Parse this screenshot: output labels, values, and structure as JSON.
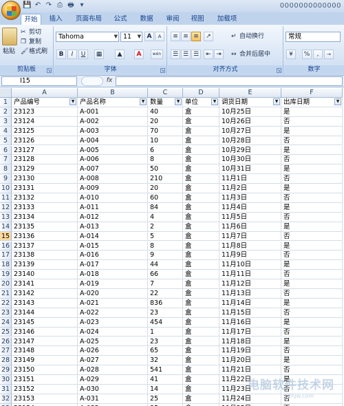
{
  "window": {
    "title": "0000000000000"
  },
  "quick_access": {
    "icons": [
      "save-icon",
      "undo-icon",
      "redo-icon",
      "print-preview-icon",
      "quick-print-icon",
      "customize-icon"
    ]
  },
  "tabs": [
    {
      "label": "开始",
      "active": true
    },
    {
      "label": "插入"
    },
    {
      "label": "页面布局"
    },
    {
      "label": "公式"
    },
    {
      "label": "数据"
    },
    {
      "label": "审阅"
    },
    {
      "label": "视图"
    },
    {
      "label": "加载项"
    }
  ],
  "ribbon": {
    "clipboard": {
      "label": "剪贴板",
      "paste": "粘贴",
      "cut": "剪切",
      "copy": "复制",
      "format_painter": "格式刷"
    },
    "font": {
      "label": "字体",
      "font_name": "Tahoma",
      "font_size": "11",
      "grow": "A",
      "shrink": "A",
      "bold": "B",
      "italic": "I",
      "underline": "U",
      "font_color_glyph": "A",
      "phonetic": "wén"
    },
    "alignment": {
      "label": "对齐方式",
      "wrap_text": "自动换行",
      "merge_center": "合并后居中"
    },
    "number": {
      "label": "数字",
      "format": "常规",
      "percent": "%",
      "comma": ","
    }
  },
  "formula_bar": {
    "name_box": "I15",
    "fx": "fx",
    "formula": ""
  },
  "columns": [
    "A",
    "B",
    "C",
    "D",
    "E",
    "F"
  ],
  "header_row": [
    "产品编号",
    "产品名称",
    "数量",
    "单位",
    "调货日期",
    "出库日期"
  ],
  "selected_row": 15,
  "rows": [
    [
      "23123",
      "A-001",
      "40",
      "盒",
      "10月25日",
      "是"
    ],
    [
      "23124",
      "A-002",
      "20",
      "盒",
      "10月26日",
      "否"
    ],
    [
      "23125",
      "A-003",
      "70",
      "盒",
      "10月27日",
      "是"
    ],
    [
      "23126",
      "A-004",
      "10",
      "盒",
      "10月28日",
      "否"
    ],
    [
      "23127",
      "A-005",
      "6",
      "盒",
      "10月29日",
      "是"
    ],
    [
      "23128",
      "A-006",
      "8",
      "盒",
      "10月30日",
      "否"
    ],
    [
      "23129",
      "A-007",
      "50",
      "盒",
      "10月31日",
      "是"
    ],
    [
      "23130",
      "A-008",
      "210",
      "盒",
      "11月1日",
      "否"
    ],
    [
      "23131",
      "A-009",
      "20",
      "盒",
      "11月2日",
      "是"
    ],
    [
      "23132",
      "A-010",
      "60",
      "盒",
      "11月3日",
      "否"
    ],
    [
      "23133",
      "A-011",
      "84",
      "盒",
      "11月4日",
      "是"
    ],
    [
      "23134",
      "A-012",
      "4",
      "盒",
      "11月5日",
      "否"
    ],
    [
      "23135",
      "A-013",
      "2",
      "盒",
      "11月6日",
      "是"
    ],
    [
      "23136",
      "A-014",
      "5",
      "盒",
      "11月7日",
      "否"
    ],
    [
      "23137",
      "A-015",
      "8",
      "盒",
      "11月8日",
      "是"
    ],
    [
      "23138",
      "A-016",
      "9",
      "盒",
      "11月9日",
      "否"
    ],
    [
      "23139",
      "A-017",
      "44",
      "盒",
      "11月10日",
      "是"
    ],
    [
      "23140",
      "A-018",
      "66",
      "盒",
      "11月11日",
      "否"
    ],
    [
      "23141",
      "A-019",
      "7",
      "盒",
      "11月12日",
      "是"
    ],
    [
      "23142",
      "A-020",
      "22",
      "盒",
      "11月13日",
      "否"
    ],
    [
      "23143",
      "A-021",
      "836",
      "盒",
      "11月14日",
      "是"
    ],
    [
      "23144",
      "A-022",
      "23",
      "盒",
      "11月15日",
      "否"
    ],
    [
      "23145",
      "A-023",
      "454",
      "盒",
      "11月16日",
      "是"
    ],
    [
      "23146",
      "A-024",
      "1",
      "盒",
      "11月17日",
      "否"
    ],
    [
      "23147",
      "A-025",
      "23",
      "盒",
      "11月18日",
      "是"
    ],
    [
      "23148",
      "A-026",
      "65",
      "盒",
      "11月19日",
      "否"
    ],
    [
      "23149",
      "A-027",
      "32",
      "盒",
      "11月20日",
      "是"
    ],
    [
      "23150",
      "A-028",
      "541",
      "盒",
      "11月21日",
      "否"
    ],
    [
      "23151",
      "A-029",
      "41",
      "盒",
      "11月22日",
      "是"
    ],
    [
      "23152",
      "A-030",
      "14",
      "盒",
      "11月23日",
      "否"
    ],
    [
      "23153",
      "A-031",
      "25",
      "盒",
      "11月24日",
      "否"
    ],
    [
      "23154",
      "A-032",
      "35",
      "盒",
      "11月25日",
      "否"
    ]
  ],
  "watermark": {
    "text": "电脑软件技术网",
    "sub": "52hjw.com"
  }
}
